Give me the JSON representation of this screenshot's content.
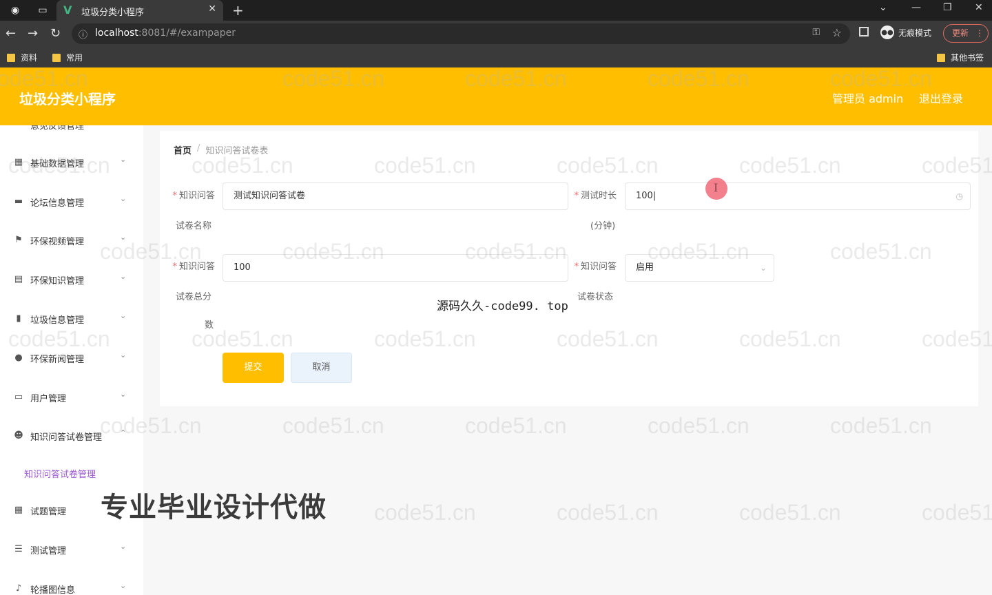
{
  "browser": {
    "tab_title": "垃圾分类小程序",
    "url_host": "localhost",
    "url_rest": ":8081/#/exampaper",
    "incognito_label": "无痕模式",
    "update_label": "更新",
    "bookmarks": [
      "资料",
      "常用"
    ],
    "other_bookmarks": "其他书签"
  },
  "header": {
    "title": "垃圾分类小程序",
    "role": "管理员 admin",
    "logout": "退出登录"
  },
  "sidebar": {
    "cut_item": "意见反馈管理",
    "items": [
      {
        "label": "基础数据管理",
        "icon": "grid"
      },
      {
        "label": "论坛信息管理",
        "icon": "monitor"
      },
      {
        "label": "环保视频管理",
        "icon": "flag"
      },
      {
        "label": "环保知识管理",
        "icon": "doc"
      },
      {
        "label": "垃圾信息管理",
        "icon": "bars"
      },
      {
        "label": "环保新闻管理",
        "icon": "bulb"
      },
      {
        "label": "用户管理",
        "icon": "chat"
      },
      {
        "label": "知识问答试卷管理",
        "icon": "user"
      },
      {
        "label": "试题管理",
        "icon": "keyboard"
      },
      {
        "label": "测试管理",
        "icon": "list"
      },
      {
        "label": "轮播图信息",
        "icon": "mic"
      }
    ],
    "active_sub": "知识问答试卷管理"
  },
  "breadcrumb": {
    "home": "首页",
    "separator": "/",
    "current": "知识问答试卷表"
  },
  "form": {
    "name_label": "知识问答",
    "name_sub": "试卷名称",
    "name_value": "测试知识问答试卷",
    "duration_label": "测试时长",
    "duration_sub": "(分钟)",
    "duration_value": "100",
    "score_label": "知识问答",
    "score_sub1": "试卷总分",
    "score_sub2": "数",
    "score_value": "100",
    "status_label": "知识问答",
    "status_sub": "试卷状态",
    "status_value": "启用",
    "submit": "提交",
    "cancel": "取消"
  },
  "overlays": {
    "code_text": "源码久久-code99. top",
    "ad_text": "专业毕业设计代做",
    "watermark": "code51.cn"
  }
}
